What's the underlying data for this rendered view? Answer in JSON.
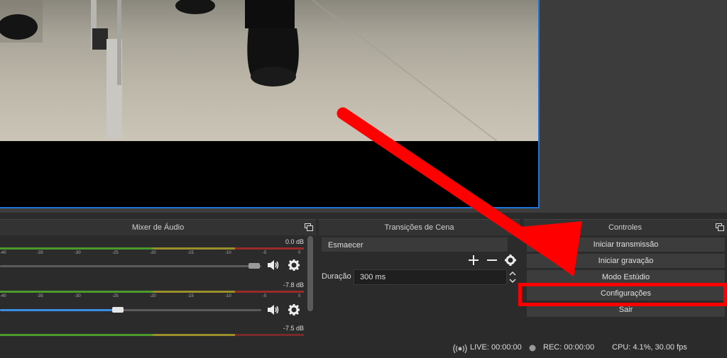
{
  "mixer": {
    "title": "Mixer de Áudio",
    "tick_labels": [
      "-40",
      "-35",
      "-30",
      "-25",
      "-20",
      "-15",
      "-10",
      "-5",
      "0"
    ],
    "channels": [
      {
        "db": "0.0 dB",
        "volume": 1.0,
        "muted": true
      },
      {
        "db": "-7.8 dB",
        "volume": 0.45,
        "muted": false
      },
      {
        "db": "-7.5 dB"
      }
    ]
  },
  "transitions": {
    "title": "Transições de Cena",
    "selected": "Esmaecer",
    "duration_label": "Duração",
    "duration_value": "300 ms"
  },
  "controls": {
    "title": "Controles",
    "start_stream": "Iniciar transmissão",
    "start_record": "Iniciar gravação",
    "studio_mode": "Modo Estúdio",
    "settings": "Configurações",
    "exit": "Sair"
  },
  "status": {
    "live": "LIVE: 00:00:00",
    "rec": "REC: 00:00:00",
    "cpu": "CPU: 4.1%, 30.00 fps"
  },
  "colors": {
    "annotation_arrow": "#ff0000",
    "preview_border": "#1e74d6",
    "volume_fill": "#3a8ee6"
  }
}
